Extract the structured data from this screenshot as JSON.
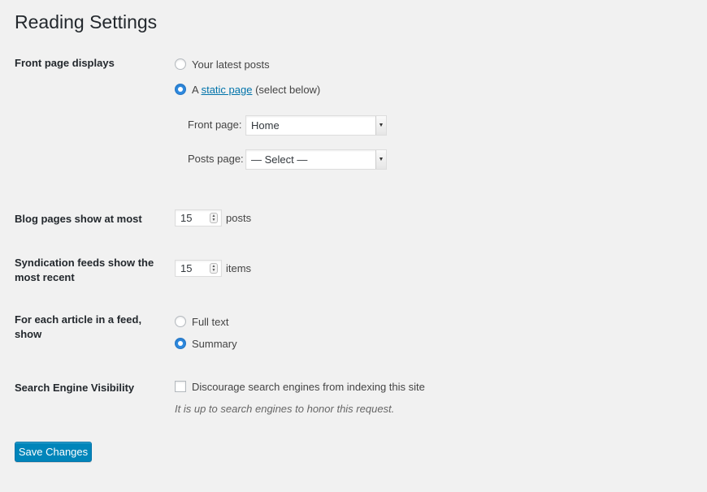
{
  "page": {
    "title": "Reading Settings"
  },
  "front_page": {
    "label": "Front page displays",
    "options": [
      {
        "label": "Your latest posts",
        "checked": false
      },
      {
        "prefix": "A ",
        "link": "static page",
        "suffix": " (select below)",
        "checked": true
      }
    ],
    "front_page_label": "Front page:",
    "front_page_value": "Home",
    "posts_page_label": "Posts page:",
    "posts_page_value": "— Select —"
  },
  "blog_pages": {
    "label": "Blog pages show at most",
    "value": "15",
    "unit": "posts"
  },
  "syndication": {
    "label": "Syndication feeds show the most recent",
    "value": "15",
    "unit": "items"
  },
  "feed_article": {
    "label": "For each article in a feed, show",
    "options": [
      {
        "label": "Full text",
        "checked": false
      },
      {
        "label": "Summary",
        "checked": true
      }
    ]
  },
  "search_visibility": {
    "label": "Search Engine Visibility",
    "checkbox_label": "Discourage search engines from indexing this site",
    "checked": false,
    "note": "It is up to search engines to honor this request."
  },
  "actions": {
    "save_label": "Save Changes"
  },
  "colors": {
    "accent": "#0085ba",
    "radio_checked": "#2e8ae0",
    "background": "#f1f1f1"
  }
}
